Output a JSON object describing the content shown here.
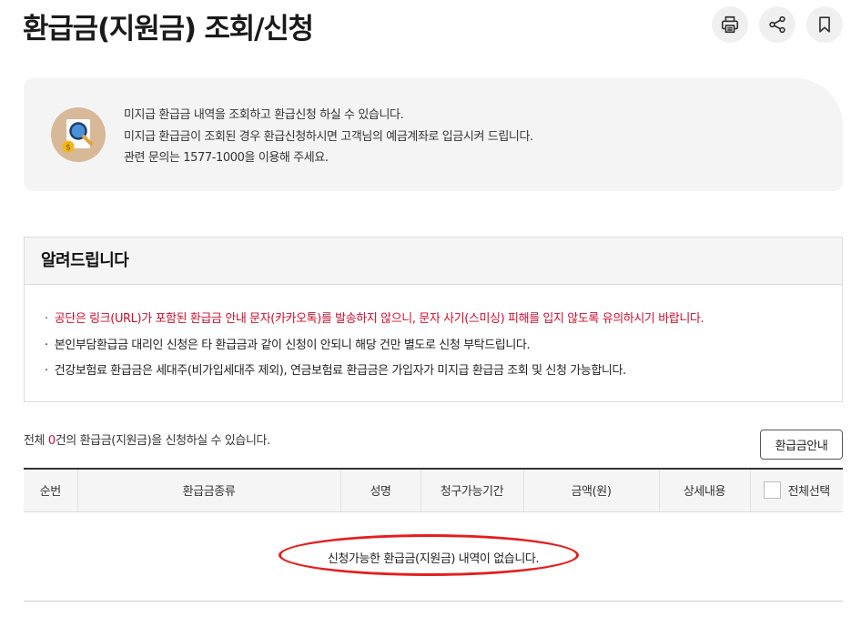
{
  "page": {
    "title": "환급금(지원금) 조회/신청"
  },
  "toolbar": {
    "icons": [
      "printer-icon",
      "share-icon",
      "bookmark-icon"
    ]
  },
  "info": {
    "icon": "search-document-icon",
    "lines": [
      "미지급 환급금 내역을 조회하고 환급신청 하실 수 있습니다.",
      "미지급 환급금이 조회된 경우 환급신청하시면 고객님의 예금계좌로 입금시켜 드립니다.",
      "관련 문의는 1577-1000을 이용해 주세요."
    ]
  },
  "notice": {
    "heading": "알려드립니다",
    "items": [
      "공단은 링크(URL)가 포함된 환급금 안내 문자(카카오톡)를 발송하지 않으니, 문자 사기(스미싱) 피해를 입지 않도록 유의하시기 바랍니다.",
      "본인부담환급금 대리인 신청은 타 환급금과 같이 신청이 안되니 해당 건만 별도로 신청 부탁드립니다.",
      "건강보험료 환급금은 세대주(비가입세대주 제외), 연금보험료 환급금은 가입자가 미지급 환급금 조회 및 신청 가능합니다."
    ],
    "highlight_color": "#c8102e"
  },
  "summary": {
    "prefix": "전체 ",
    "count": "0",
    "suffix": "건의 환급금(지원금)을 신청하실 수 있습니다."
  },
  "guide_button": {
    "label": "환급금안내"
  },
  "table": {
    "columns": [
      "순번",
      "환급금종류",
      "성명",
      "청구가능기간",
      "금액(원)",
      "상세내용"
    ],
    "select_all_label": "전체선택",
    "empty_message": "신청가능한 환급금(지원금) 내역이 없습니다."
  },
  "annotation": {
    "color": "#e41e1e"
  }
}
